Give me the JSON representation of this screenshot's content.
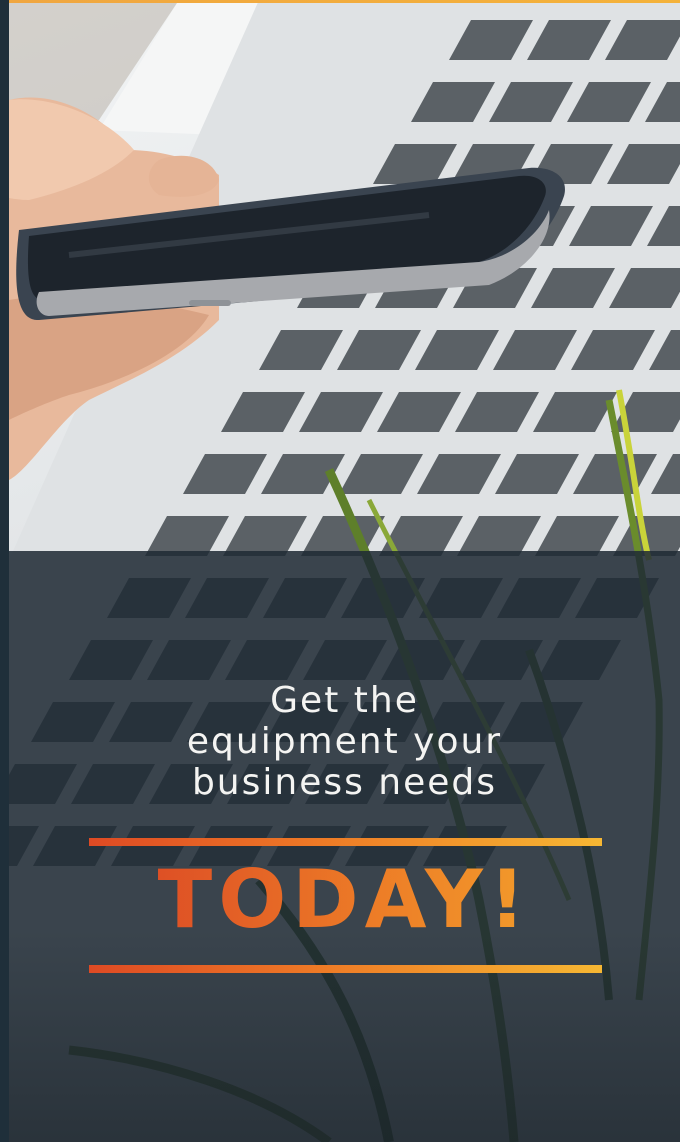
{
  "banner": {
    "headline_lines": [
      "Get the",
      "equipment your",
      "business needs"
    ],
    "emphasis": "TODAY!"
  },
  "colors": {
    "overlay": "#1e2a34",
    "text": "#f4f4f2",
    "accent_start": "#de4a24",
    "accent_mid": "#ee7a26",
    "accent_end": "#f6b733",
    "left_edge": "#1f2f3a"
  },
  "image": {
    "subject": "hand holding smartphone above laptop keyboard with plant leaves"
  }
}
